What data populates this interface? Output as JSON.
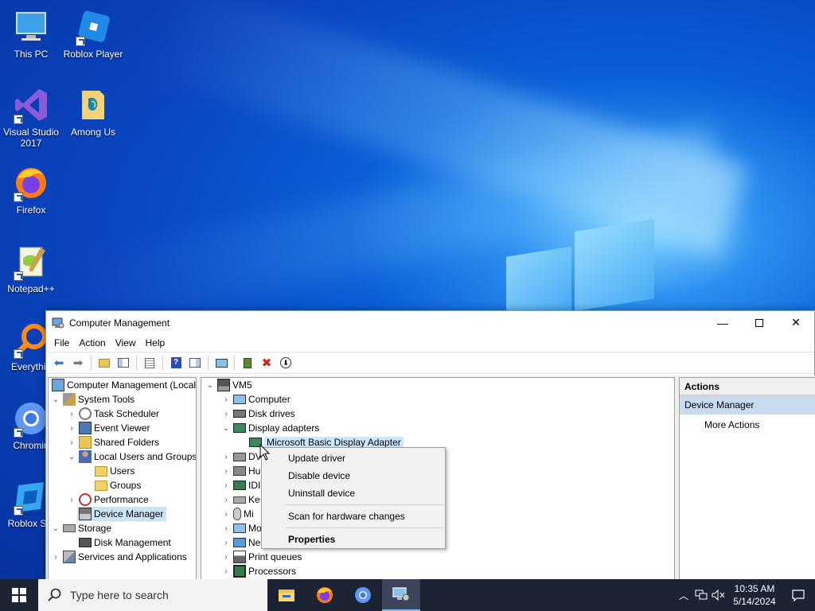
{
  "desktop": {
    "icons": [
      {
        "label": "This PC"
      },
      {
        "label": "Roblox Player"
      },
      {
        "label": "Visual Studio 2017"
      },
      {
        "label": "Among Us"
      },
      {
        "label": "Firefox"
      },
      {
        "label": "Notepad++"
      },
      {
        "label": "Everythin"
      },
      {
        "label": "Chromiu"
      },
      {
        "label": "Roblox Stu"
      }
    ]
  },
  "window": {
    "title": "Computer Management",
    "menu": [
      "File",
      "Action",
      "View",
      "Help"
    ],
    "left_tree": [
      {
        "label": "Computer Management (Local"
      },
      {
        "label": "System Tools"
      },
      {
        "label": "Task Scheduler"
      },
      {
        "label": "Event Viewer"
      },
      {
        "label": "Shared Folders"
      },
      {
        "label": "Local Users and Groups"
      },
      {
        "label": "Users"
      },
      {
        "label": "Groups"
      },
      {
        "label": "Performance"
      },
      {
        "label": "Device Manager"
      },
      {
        "label": "Storage"
      },
      {
        "label": "Disk Management"
      },
      {
        "label": "Services and Applications"
      }
    ],
    "device_tree": [
      {
        "label": "VM5"
      },
      {
        "label": "Computer"
      },
      {
        "label": "Disk drives"
      },
      {
        "label": "Display adapters"
      },
      {
        "label": "Microsoft Basic Display Adapter"
      },
      {
        "label": "DV"
      },
      {
        "label": "Hu"
      },
      {
        "label": "IDI"
      },
      {
        "label": "Ke"
      },
      {
        "label": "Mi"
      },
      {
        "label": "Mo"
      },
      {
        "label": "Ne"
      },
      {
        "label": "Print queues"
      },
      {
        "label": "Processors"
      }
    ],
    "actions": {
      "header": "Actions",
      "section": "Device Manager",
      "more": "More Actions"
    }
  },
  "context_menu": {
    "items": [
      "Update driver",
      "Disable device",
      "Uninstall device",
      "Scan for hardware changes",
      "Properties"
    ]
  },
  "taskbar": {
    "search_placeholder": "Type here to search",
    "time": "10:35 AM",
    "date": "5/14/2024"
  }
}
